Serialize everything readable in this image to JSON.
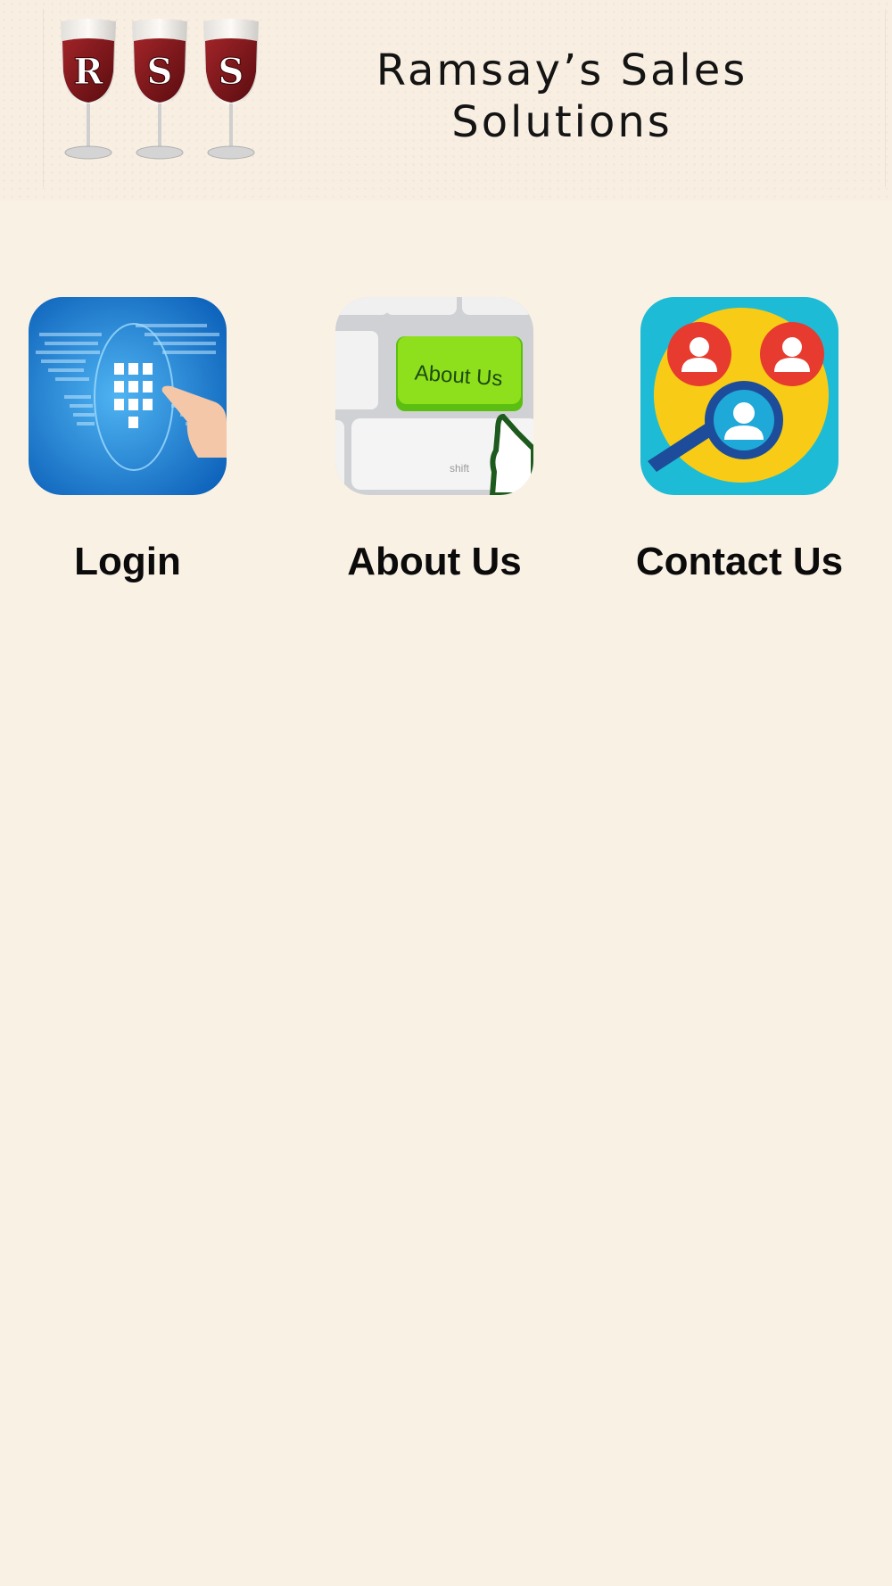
{
  "header": {
    "logo_letters": [
      "R",
      "S",
      "S"
    ],
    "brand_line1": "Ramsay’s Sales",
    "brand_line2": "Solutions"
  },
  "menu": [
    {
      "id": "login",
      "label": "Login",
      "icon": "keypad-login-icon"
    },
    {
      "id": "about",
      "label": "About Us",
      "icon": "about-us-key-icon"
    },
    {
      "id": "contact",
      "label": "Contact Us",
      "icon": "contacts-search-icon"
    }
  ],
  "colors": {
    "background": "#faf1e5",
    "wine": "#7a1418",
    "login_blue": "#1a7fd4",
    "about_green": "#8ee01c",
    "contact_cyan": "#1ebbd6",
    "contact_yellow": "#f8cc16",
    "contact_red": "#e63b2e"
  }
}
